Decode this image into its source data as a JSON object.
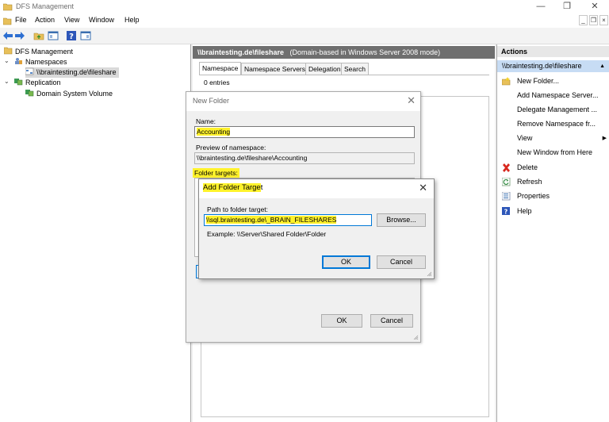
{
  "window": {
    "title": "DFS Management",
    "minimize": "—",
    "restore": "❐",
    "close": "✕"
  },
  "menu": {
    "items": [
      "File",
      "Action",
      "View",
      "Window",
      "Help"
    ],
    "mdi_minimize": "_",
    "mdi_restore": "❐",
    "mdi_close": "×"
  },
  "tree": {
    "root": "DFS Management",
    "namespaces": "Namespaces",
    "namespace_item": "\\\\braintesting.de\\fileshare",
    "replication": "Replication",
    "replication_item": "Domain System Volume"
  },
  "center": {
    "header_path": "\\\\braintesting.de\\fileshare",
    "header_mode": "(Domain-based in Windows Server 2008 mode)",
    "tabs": [
      "Namespace",
      "Namespace Servers",
      "Delegation",
      "Search"
    ],
    "entries": "0 entries"
  },
  "actions": {
    "title": "Actions",
    "subheader": "\\\\braintesting.de\\fileshare",
    "items": [
      {
        "label": "New Folder...",
        "icon": "new-folder-icon"
      },
      {
        "label": "Add Namespace Server..."
      },
      {
        "label": "Delegate Management ..."
      },
      {
        "label": "Remove Namespace fr..."
      },
      {
        "label": "View",
        "submenu": "▶"
      },
      {
        "label": "New Window from Here"
      },
      {
        "label": "Delete",
        "icon": "delete-icon"
      },
      {
        "label": "Refresh",
        "icon": "refresh-icon"
      },
      {
        "label": "Properties",
        "icon": "properties-icon"
      },
      {
        "label": "Help",
        "icon": "help-icon"
      }
    ]
  },
  "new_folder": {
    "title": "New Folder",
    "name_label": "Name:",
    "name_value": "Accounting",
    "preview_label": "Preview of namespace:",
    "preview_value": "\\\\braintesting.de\\fileshare\\Accounting",
    "targets_label": "Folder targets:",
    "ok": "OK",
    "cancel": "Cancel"
  },
  "add_target": {
    "title_highlight": "Add Folder Targe",
    "title_rest": "t",
    "path_label": "Path to folder target:",
    "path_value": "\\\\sql.braintesting.de\\_BRAIN_FILESHARES",
    "browse": "Browse...",
    "example": "Example: \\\\Server\\Shared Folder\\Folder",
    "ok": "OK",
    "cancel": "Cancel"
  },
  "colors": {
    "highlight": "#fff22b",
    "header": "#6f6f6f",
    "selection": "#c7dcf4",
    "accent": "#0078d7"
  }
}
